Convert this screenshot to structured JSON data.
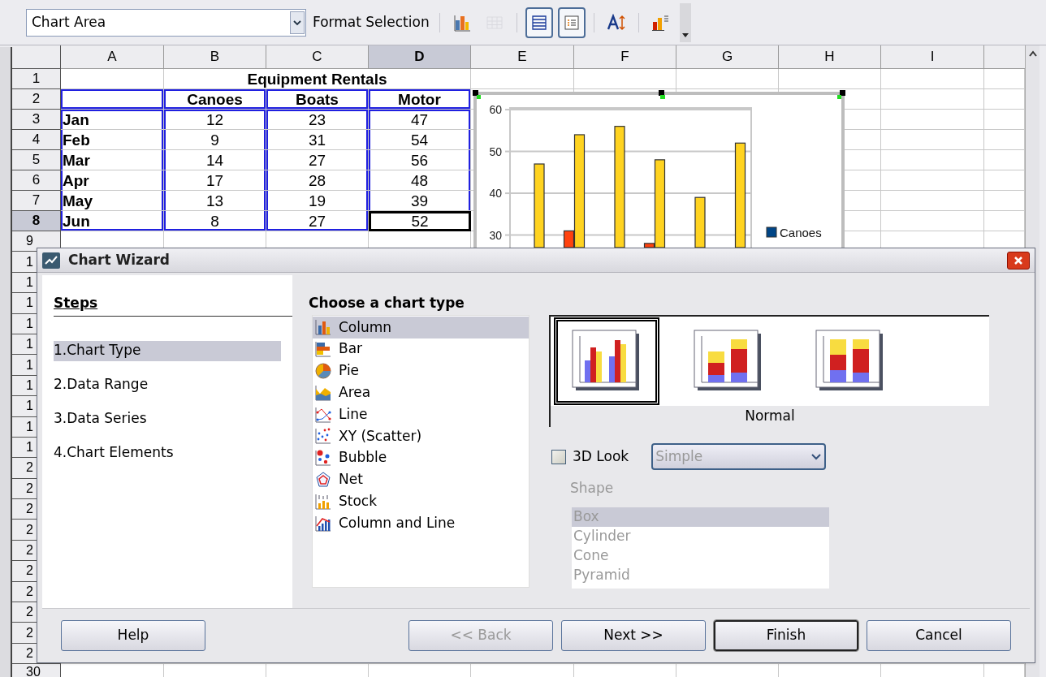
{
  "toolbar": {
    "object_select": "Chart Area",
    "format_label": "Format Selection",
    "tools": [
      {
        "kind": "chart-type",
        "on": false,
        "disabled": false
      },
      {
        "kind": "data-table",
        "on": false,
        "disabled": true
      },
      {
        "kind": "grid",
        "on": true,
        "disabled": false
      },
      {
        "kind": "legend",
        "on": true,
        "disabled": false
      },
      {
        "kind": "scale-text",
        "on": false,
        "disabled": false
      },
      {
        "kind": "auto-layout",
        "on": false,
        "disabled": false
      }
    ]
  },
  "sheet": {
    "columns": [
      {
        "label": "A",
        "selected": false
      },
      {
        "label": "B",
        "selected": false
      },
      {
        "label": "C",
        "selected": false
      },
      {
        "label": "D",
        "selected": true
      },
      {
        "label": "E",
        "selected": false
      },
      {
        "label": "F",
        "selected": false
      },
      {
        "label": "G",
        "selected": false
      },
      {
        "label": "H",
        "selected": false
      },
      {
        "label": "I",
        "selected": false
      }
    ],
    "title": "Equipment Rentals",
    "series_headers": [
      "Canoes",
      "Boats",
      "Motor"
    ],
    "rows": [
      {
        "number": "1",
        "selected": false
      },
      {
        "number": "2",
        "selected": false
      },
      {
        "number": "3",
        "label": "Jan",
        "values": [
          "12",
          "23",
          "47"
        ],
        "selected": false
      },
      {
        "number": "4",
        "label": "Feb",
        "values": [
          "9",
          "31",
          "54"
        ],
        "selected": false
      },
      {
        "number": "5",
        "label": "Mar",
        "values": [
          "14",
          "27",
          "56"
        ],
        "selected": false
      },
      {
        "number": "6",
        "label": "Apr",
        "values": [
          "17",
          "28",
          "48"
        ],
        "selected": false
      },
      {
        "number": "7",
        "label": "May",
        "values": [
          "13",
          "19",
          "39"
        ],
        "selected": false
      },
      {
        "number": "8",
        "label": "Jun",
        "values": [
          "8",
          "27",
          "52"
        ],
        "selected": true
      }
    ],
    "more_rows": [
      "9",
      "1",
      "1",
      "1",
      "1",
      "1",
      "1",
      "1",
      "1",
      "1",
      "1",
      "2",
      "2",
      "2",
      "2",
      "2",
      "2",
      "2",
      "2",
      "2",
      "2",
      "30"
    ]
  },
  "chart": {
    "chart_data": {
      "type": "bar",
      "grid": true,
      "series": [
        {
          "name": "Canoes",
          "color": "#004586",
          "values": [
            null,
            null,
            null,
            null,
            null,
            null
          ]
        },
        {
          "color": "#ff420e",
          "values": [
            null,
            31,
            null,
            28,
            null,
            null
          ]
        },
        {
          "color": "#ffd320",
          "values": [
            47,
            54,
            56,
            48,
            39,
            52
          ]
        }
      ],
      "ylim": [
        27,
        60.4
      ],
      "yticks": [
        30,
        40,
        50,
        60
      ]
    }
  },
  "dialog": {
    "title": "Chart Wizard",
    "steps_heading": "Steps",
    "steps": [
      {
        "label": "1.Chart Type",
        "selected": true
      },
      {
        "label": "2.Data Range",
        "selected": false
      },
      {
        "label": "3.Data Series",
        "selected": false
      },
      {
        "label": "4.Chart Elements",
        "selected": false
      }
    ],
    "heading": "Choose a chart type",
    "chart_types": [
      {
        "kind": "column",
        "label": "Column",
        "selected": true
      },
      {
        "kind": "bar",
        "label": "Bar",
        "selected": false
      },
      {
        "kind": "pie",
        "label": "Pie",
        "selected": false
      },
      {
        "kind": "area",
        "label": "Area",
        "selected": false
      },
      {
        "kind": "line",
        "label": "Line",
        "selected": false
      },
      {
        "kind": "scatter",
        "label": "XY (Scatter)",
        "selected": false
      },
      {
        "kind": "bubble",
        "label": "Bubble",
        "selected": false
      },
      {
        "kind": "net",
        "label": "Net",
        "selected": false
      },
      {
        "kind": "stock",
        "label": "Stock",
        "selected": false
      },
      {
        "kind": "column-line",
        "label": "Column and Line",
        "selected": false
      }
    ],
    "variants": [
      {
        "kind": "normal",
        "selected": true
      },
      {
        "kind": "stacked",
        "selected": false
      },
      {
        "kind": "percent",
        "selected": false
      }
    ],
    "variant_label": "Normal",
    "look_3d": {
      "label": "3D Look",
      "checked": false
    },
    "look_select": {
      "value": "Simple",
      "disabled": true
    },
    "shape_label": "Shape",
    "shapes": [
      {
        "label": "Box",
        "selected": true
      },
      {
        "label": "Cylinder",
        "selected": false
      },
      {
        "label": "Cone",
        "selected": false
      },
      {
        "label": "Pyramid",
        "selected": false
      }
    ],
    "buttons": [
      {
        "label": "Help",
        "disabled": false,
        "default": false
      },
      {
        "label": "<< Back",
        "disabled": true,
        "default": false
      },
      {
        "label": "Next >>",
        "disabled": false,
        "default": false
      },
      {
        "label": "Finish",
        "disabled": false,
        "default": true
      },
      {
        "label": "Cancel",
        "disabled": false,
        "default": false
      }
    ]
  }
}
